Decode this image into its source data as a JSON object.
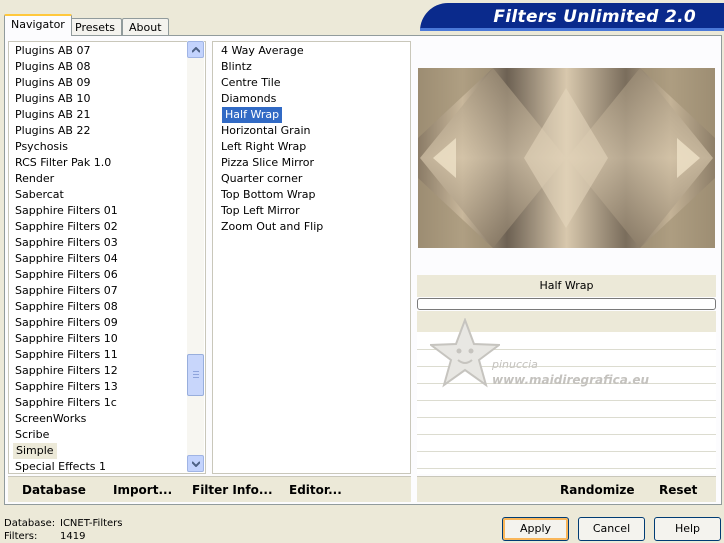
{
  "tabs": [
    "Navigator",
    "Presets",
    "About"
  ],
  "banner_title": "Filters Unlimited 2.0",
  "categories": [
    "Plugins AB 07",
    "Plugins AB 08",
    "Plugins AB 09",
    "Plugins AB 10",
    "Plugins AB 21",
    "Plugins AB 22",
    "Psychosis",
    "RCS Filter Pak 1.0",
    "Render",
    "Sabercat",
    "Sapphire Filters 01",
    "Sapphire Filters 02",
    "Sapphire Filters 03",
    "Sapphire Filters 04",
    "Sapphire Filters 06",
    "Sapphire Filters 07",
    "Sapphire Filters 08",
    "Sapphire Filters 09",
    "Sapphire Filters 10",
    "Sapphire Filters 11",
    "Sapphire Filters 12",
    "Sapphire Filters 13",
    "Sapphire Filters 1c",
    "ScreenWorks",
    "Scribe",
    "Simple",
    "Special Effects 1"
  ],
  "selected_category": "Simple",
  "filters": [
    "4 Way Average",
    "Blintz",
    "Centre Tile",
    "Diamonds",
    "Half Wrap",
    "Horizontal Grain",
    "Left Right Wrap",
    "Pizza Slice Mirror",
    "Quarter corner",
    "Top Bottom Wrap",
    "Top Left Mirror",
    "Zoom Out and Flip"
  ],
  "selected_filter": "Half Wrap",
  "filter_name_display": "Half Wrap",
  "progress": 0,
  "watermark": {
    "line1": "pinuccia",
    "line2": "www.maidiregrafica.eu"
  },
  "left_actions": [
    "Database",
    "Import...",
    "Filter Info...",
    "Editor..."
  ],
  "right_actions": [
    "Randomize",
    "Reset"
  ],
  "status": {
    "database_label": "Database:",
    "database_value": "ICNET-Filters",
    "filters_label": "Filters:",
    "filters_value": "1419"
  },
  "buttons": {
    "apply": "Apply",
    "cancel": "Cancel",
    "help": "Help"
  },
  "colors": {
    "banner": "#0a2a8c",
    "selection": "#316ac5",
    "accent_tab": "#ffc83c"
  }
}
